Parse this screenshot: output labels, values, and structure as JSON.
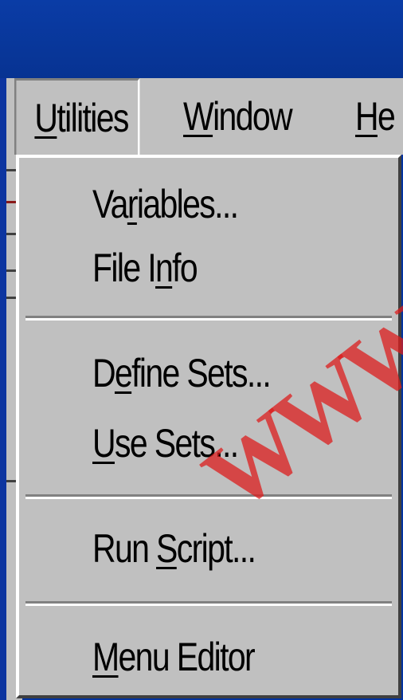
{
  "menubar": {
    "items": [
      {
        "prefix": "",
        "mnemonic": "U",
        "rest": "tilities"
      },
      {
        "prefix": "",
        "mnemonic": "W",
        "rest": "indow"
      },
      {
        "prefix": "",
        "mnemonic": "H",
        "rest": "e"
      }
    ]
  },
  "dropdown": {
    "items": [
      {
        "prefix": "Va",
        "mnemonic": "r",
        "rest": "iables..."
      },
      {
        "prefix": "File I",
        "mnemonic": "n",
        "rest": "fo"
      },
      {
        "prefix": "D",
        "mnemonic": "e",
        "rest": "fine Sets..."
      },
      {
        "prefix": "",
        "mnemonic": "U",
        "rest": "se Sets..."
      },
      {
        "prefix": "Run ",
        "mnemonic": "S",
        "rest": "cript..."
      },
      {
        "prefix": "",
        "mnemonic": "M",
        "rest": "enu Editor"
      }
    ]
  },
  "watermark": {
    "text": "WWW"
  },
  "colors": {
    "titlebar": "#0a3ca6",
    "menu_face": "#c0c0c0",
    "text": "#000000",
    "watermark": "#dc1e1e"
  }
}
